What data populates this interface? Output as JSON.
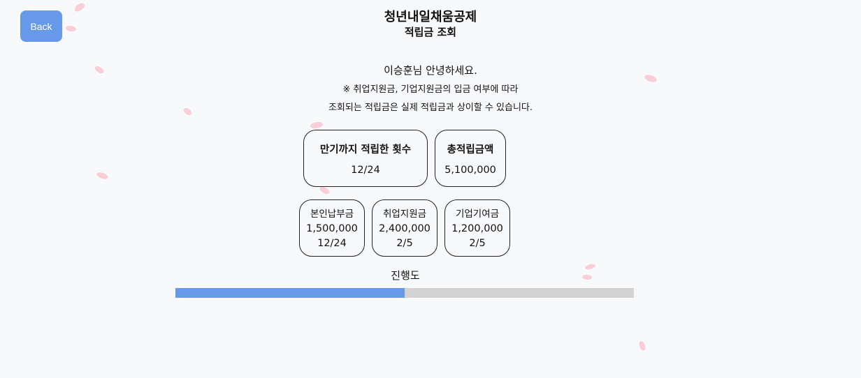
{
  "header": {
    "back_label": "Back",
    "title": "청년내일채움공제",
    "subtitle": "적립금 조회"
  },
  "greeting": "이승훈님 안녕하세요.",
  "notice": {
    "line1": "※ 취업지원금, 기업지원금의 입금 여부에 따라",
    "line2": "조회되는 적립금은 실제 적립금과 상이할 수 있습니다."
  },
  "summary": {
    "count_title": "만기까지 적립한 횟수",
    "count_value": "12/24",
    "total_title": "총적립금액",
    "total_value": "5,100,000"
  },
  "breakdown": [
    {
      "label": "본인납부금",
      "amount": "1,500,000",
      "count": "12/24"
    },
    {
      "label": "취업지원금",
      "amount": "2,400,000",
      "count": "2/5"
    },
    {
      "label": "기업기여금",
      "amount": "1,200,000",
      "count": "2/5"
    }
  ],
  "progress": {
    "label": "진행도",
    "fraction": 0.5
  },
  "colors": {
    "accent": "#6699ea",
    "track": "#d3d3d3",
    "petal": "#f9c9d3",
    "background": "#f8f9fb"
  }
}
